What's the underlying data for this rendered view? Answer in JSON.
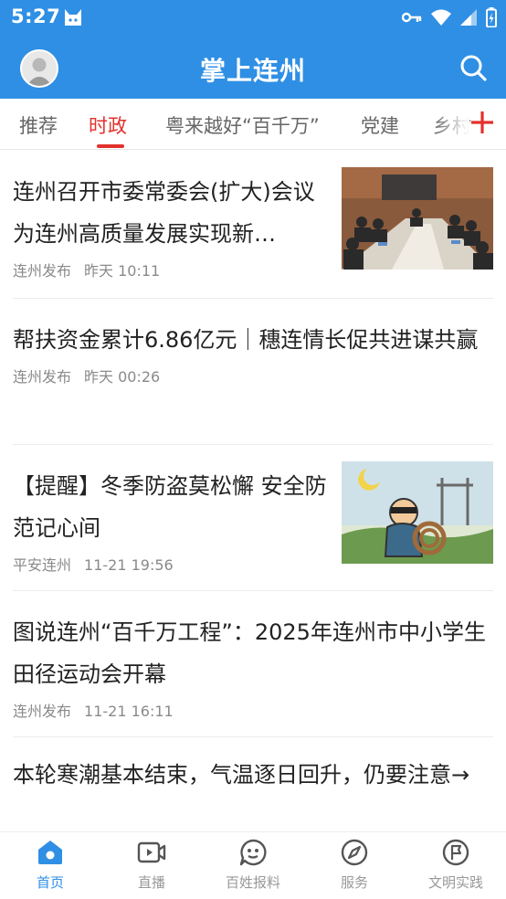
{
  "status_bar": {
    "time": "5:27"
  },
  "header": {
    "title": "掌上连州"
  },
  "tabs": [
    {
      "label": "推荐"
    },
    {
      "label": "时政"
    },
    {
      "label": "粤来越好“百千万”"
    },
    {
      "label": "党建"
    },
    {
      "label": "乡村"
    }
  ],
  "feed": [
    {
      "title": "连州召开市委常委会(扩大)会议 为连州高质量发展实现新…",
      "source": "连州发布",
      "time": "昨天 10:11"
    },
    {
      "title": "帮扶资金累计6.86亿元｜穗连情长促共进谋共赢",
      "source": "连州发布",
      "time": "昨天 00:26"
    },
    {
      "title": "【提醒】冬季防盗莫松懈 安全防范记心间",
      "source": "平安连州",
      "time": "11-21 19:56"
    },
    {
      "title": "图说连州“百千万工程”：2025年连州市中小学生田径运动会开幕",
      "source": "连州发布",
      "time": "11-21 16:11"
    },
    {
      "title": "本轮寒潮基本结束，气温逐日回升，仍要注意→"
    }
  ],
  "bottom_nav": [
    {
      "label": "首页"
    },
    {
      "label": "直播"
    },
    {
      "label": "百姓报料"
    },
    {
      "label": "服务"
    },
    {
      "label": "文明实践"
    }
  ],
  "colors": {
    "primary": "#2f8fe4",
    "accent": "#e3312d"
  }
}
